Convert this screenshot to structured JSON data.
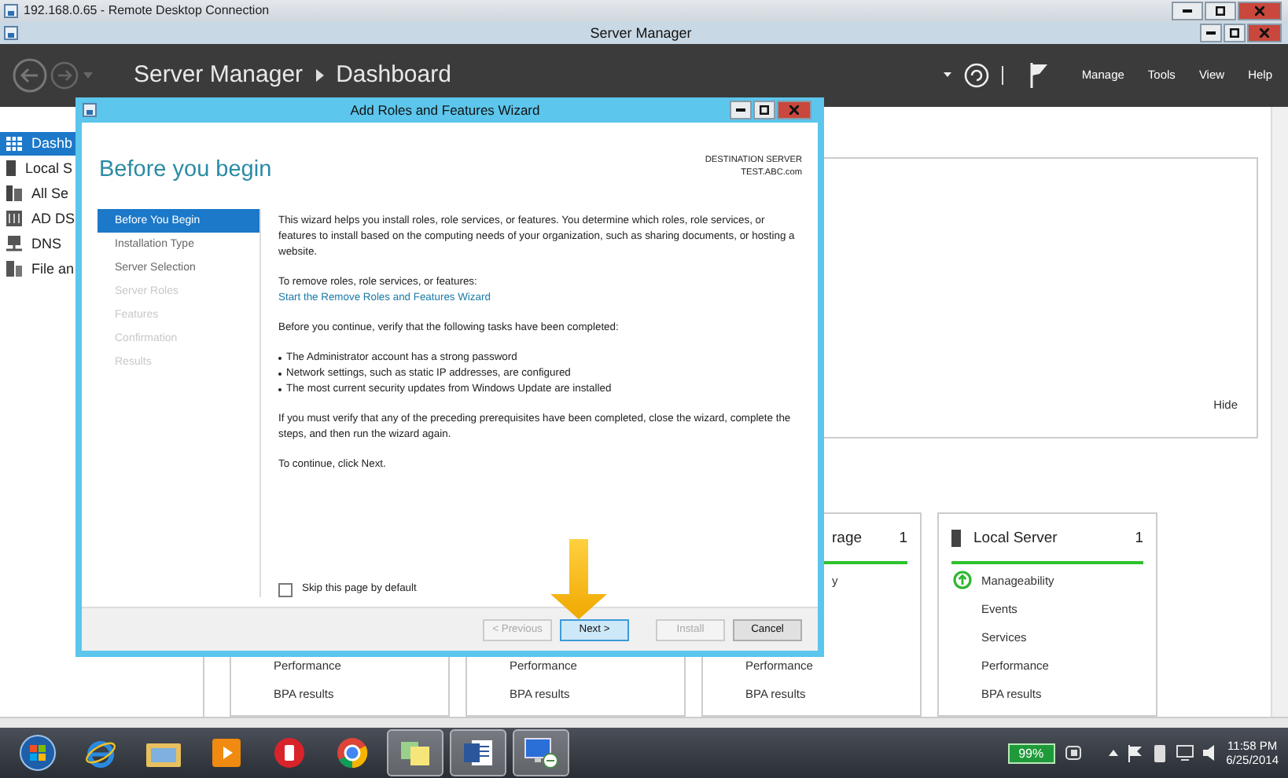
{
  "rdp_window": {
    "title": "192.168.0.65 - Remote Desktop Connection"
  },
  "app": {
    "title": "Server Manager",
    "breadcrumb": [
      "Server Manager",
      "Dashboard"
    ],
    "menu": [
      "Manage",
      "Tools",
      "View",
      "Help"
    ]
  },
  "sidebar": {
    "items": [
      {
        "label": "Dashb",
        "kind": "dashboard",
        "selected": true
      },
      {
        "label": "Local S",
        "kind": "server",
        "selected": false
      },
      {
        "label": "All Se",
        "kind": "servers",
        "selected": false
      },
      {
        "label": "AD DS",
        "kind": "directory",
        "selected": false
      },
      {
        "label": "DNS",
        "kind": "dns",
        "selected": false
      },
      {
        "label": "File an",
        "kind": "files",
        "selected": false
      }
    ]
  },
  "welcome_panel": {
    "hide_link": "Hide"
  },
  "tiles": [
    {
      "lower_items": [
        "Performance",
        "BPA results"
      ]
    },
    {
      "lower_items": [
        "Performance",
        "BPA results"
      ]
    },
    {
      "title": "rage",
      "count": "1",
      "upper_items": [
        {
          "label": "y",
          "kind": "plain"
        }
      ],
      "lower_items": [
        "Performance",
        "BPA results"
      ]
    },
    {
      "title": "Local Server",
      "count": "1",
      "upper_items": [
        {
          "label": "Manageability",
          "kind": "status"
        },
        {
          "label": "Events",
          "kind": "plain"
        },
        {
          "label": "Services",
          "kind": "plain"
        }
      ],
      "lower_items": [
        "Performance",
        "BPA results"
      ]
    }
  ],
  "wizard": {
    "title": "Add Roles and Features Wizard",
    "heading": "Before you begin",
    "destination_label": "DESTINATION SERVER",
    "destination_server": "TEST.ABC.com",
    "steps": [
      {
        "label": "Before You Begin",
        "selected": true,
        "disabled": false
      },
      {
        "label": "Installation Type",
        "selected": false,
        "disabled": false
      },
      {
        "label": "Server Selection",
        "selected": false,
        "disabled": false
      },
      {
        "label": "Server Roles",
        "selected": false,
        "disabled": true
      },
      {
        "label": "Features",
        "selected": false,
        "disabled": true
      },
      {
        "label": "Confirmation",
        "selected": false,
        "disabled": true
      },
      {
        "label": "Results",
        "selected": false,
        "disabled": true
      }
    ],
    "content": [
      {
        "kind": "paragraph",
        "text": "This wizard helps you install roles, role services, or features. You determine which roles, role services, or features to install based on the computing needs of your organization, such as sharing documents, or hosting a website."
      },
      {
        "kind": "link_block",
        "text": "To remove roles, role services, or features:",
        "link": "Start the Remove Roles and Features Wizard"
      },
      {
        "kind": "paragraph",
        "text": "Before you continue, verify that the following tasks have been completed:"
      },
      {
        "kind": "bullets",
        "items": [
          "The Administrator account has a strong password",
          "Network settings, such as static IP addresses, are configured",
          "The most current security updates from Windows Update are installed"
        ]
      },
      {
        "kind": "paragraph",
        "text": "If you must verify that any of the preceding prerequisites have been completed, close the wizard, complete the steps, and then run the wizard again."
      },
      {
        "kind": "paragraph",
        "text": "To continue, click Next."
      }
    ],
    "skip_checkbox": {
      "label": "Skip this page by default",
      "checked": false
    },
    "buttons": [
      {
        "label": "< Previous",
        "disabled": true,
        "default": false
      },
      {
        "label": "Next >",
        "disabled": false,
        "default": true
      },
      {
        "label": "Install",
        "disabled": true,
        "default": false
      },
      {
        "label": "Cancel",
        "disabled": false,
        "default": false
      }
    ]
  },
  "taskbar": {
    "apps": [
      {
        "kind": "start",
        "running": false
      },
      {
        "kind": "ie",
        "running": false
      },
      {
        "kind": "folder",
        "running": false
      },
      {
        "kind": "media",
        "running": false
      },
      {
        "kind": "redapp",
        "running": false
      },
      {
        "kind": "chrome",
        "running": false
      },
      {
        "kind": "notes",
        "running": true
      },
      {
        "kind": "word",
        "running": true
      },
      {
        "kind": "remote",
        "running": true
      }
    ],
    "battery": "99%",
    "time": "11:58 PM",
    "date": "6/25/2014"
  }
}
